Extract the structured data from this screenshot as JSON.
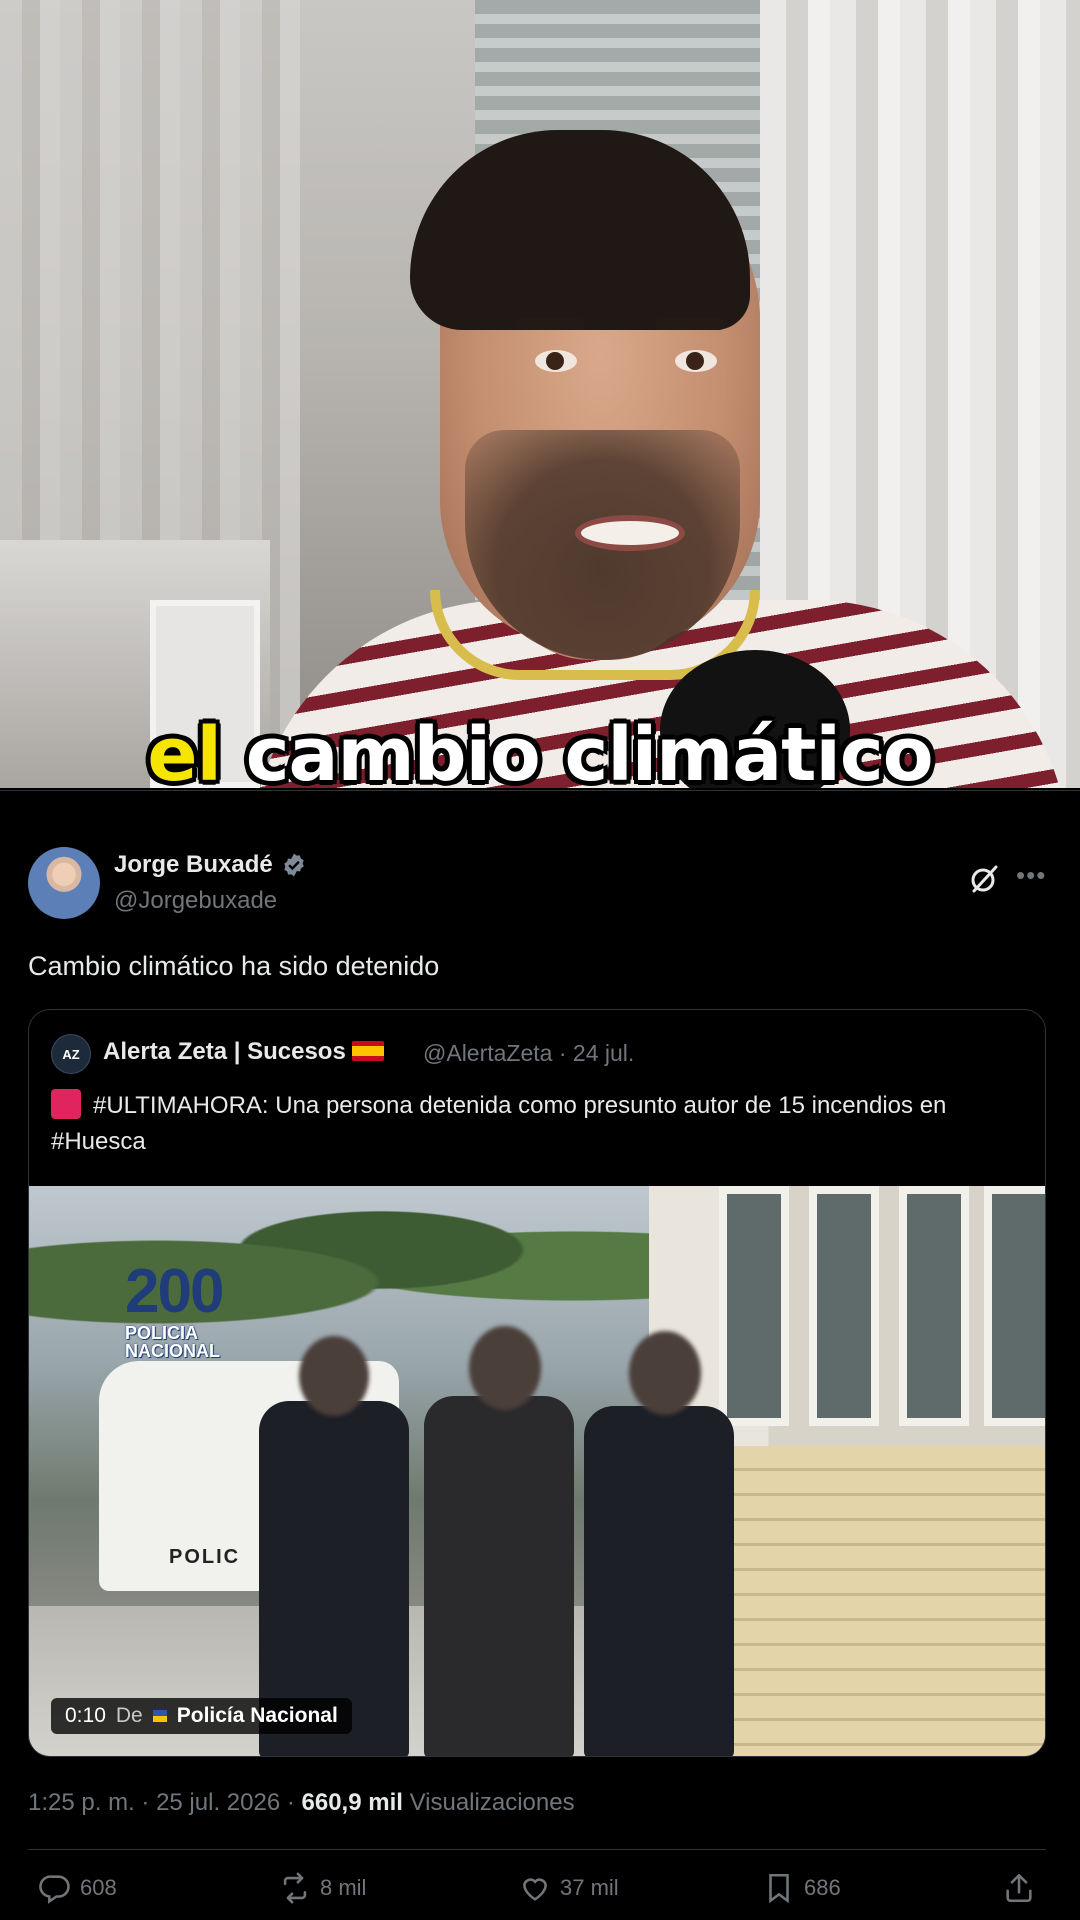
{
  "video": {
    "caption_highlight": "el",
    "caption_rest": "cambio climático"
  },
  "tweet": {
    "author_name": "Jorge Buxadé",
    "author_handle": "@Jorgebuxade",
    "text": "Cambio climático ha sido detenido",
    "quoted": {
      "avatar_text": "AZ",
      "name": "Alerta Zeta | Sucesos",
      "handle": "@AlertaZeta",
      "date": "24 jul.",
      "text": "#ULTIMAHORA: Una persona detenida como presunto autor de 15 incendios en #Huesca",
      "media": {
        "duration": "0:10",
        "by_label": "De",
        "source": "Policía Nacional",
        "logo_number": "200",
        "logo_text_line1": "POLICIA",
        "logo_text_line2": "NACIONAL",
        "van_label": "POLIC"
      }
    },
    "time": "1:25 p. m.",
    "date": "25 jul. 2026",
    "views_count": "660,9 mil",
    "views_label": "Visualizaciones",
    "actions": {
      "replies": "608",
      "reposts": "8 mil",
      "likes": "37 mil",
      "bookmarks": "686"
    }
  },
  "colors": {
    "caption_highlight": "#f5e500",
    "background": "#000000",
    "text_primary": "#e7e9ea",
    "text_secondary": "#71767b",
    "verified_blue": "#1d9bf0"
  }
}
